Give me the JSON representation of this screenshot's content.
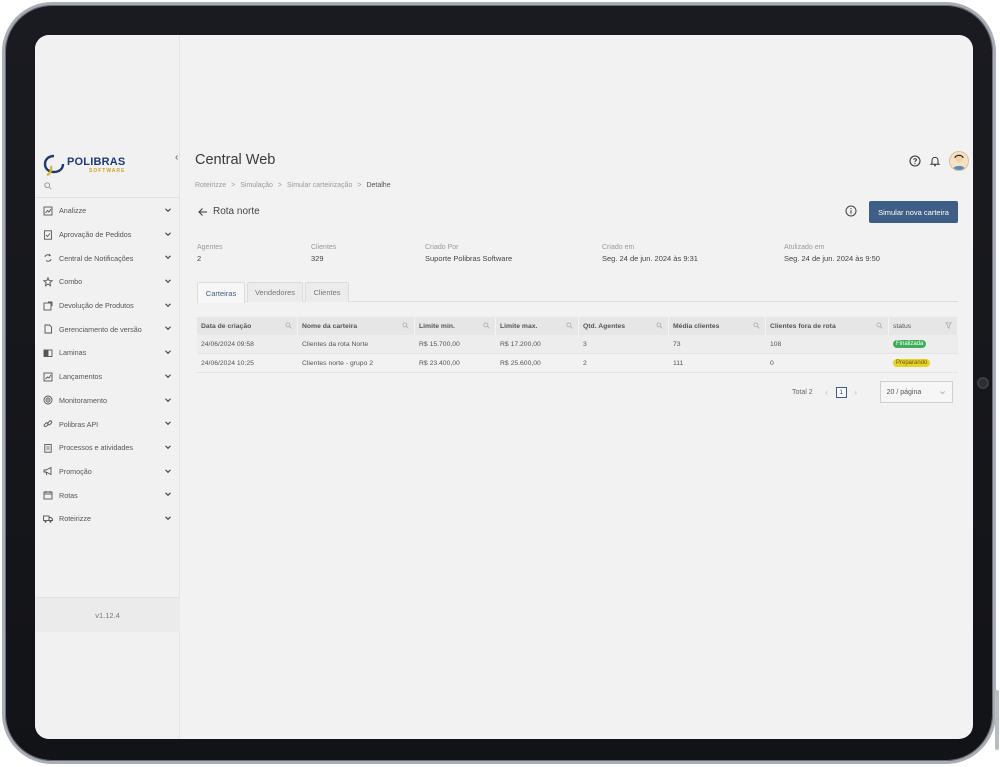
{
  "app": {
    "title": "Central Web",
    "version": "v1.12.4"
  },
  "logo": {
    "name": "POLIBRAS",
    "sub": "SOFTWARE"
  },
  "colors": {
    "primary": "#3e5e86",
    "finalizada": "#3fae5a",
    "preparando": "#e6d32a"
  },
  "sidebar": {
    "items": [
      {
        "label": "Analizze",
        "icon": "chart-icon"
      },
      {
        "label": "Aprovação de Pedidos",
        "icon": "document-check-icon"
      },
      {
        "label": "Central de Notificações",
        "icon": "sync-icon"
      },
      {
        "label": "Combo",
        "icon": "star-icon"
      },
      {
        "label": "Devolução de Produtos",
        "icon": "return-icon"
      },
      {
        "label": "Gerenciamento de versão",
        "icon": "file-icon"
      },
      {
        "label": "Laminas",
        "icon": "book-icon"
      },
      {
        "label": "Lançamentos",
        "icon": "trend-icon"
      },
      {
        "label": "Monitoramento",
        "icon": "target-icon"
      },
      {
        "label": "Polibras API",
        "icon": "link-icon"
      },
      {
        "label": "Processos e atividades",
        "icon": "clipboard-icon"
      },
      {
        "label": "Promoção",
        "icon": "megaphone-icon"
      },
      {
        "label": "Rotas",
        "icon": "calendar-icon"
      },
      {
        "label": "Roteirizze",
        "icon": "truck-icon"
      }
    ]
  },
  "breadcrumb": {
    "items": [
      "Roteirizze",
      "Simulação",
      "Simular carteirização"
    ],
    "current": "Detalhe",
    "separator": ">"
  },
  "page": {
    "title": "Rota norte",
    "primary_button": "Simular nova carteira"
  },
  "summary": [
    {
      "label": "Agentes",
      "value": "2"
    },
    {
      "label": "Clientes",
      "value": "329"
    },
    {
      "label": "Criado Por",
      "value": "Suporte Polibras Software"
    },
    {
      "label": "Criado em",
      "value": "Seg. 24 de jun. 2024 às 9:31"
    },
    {
      "label": "Atulizado em",
      "value": "Seg. 24 de jun. 2024 às 9:50"
    }
  ],
  "tabs": [
    {
      "label": "Carteiras",
      "active": true
    },
    {
      "label": "Vendedores",
      "active": false
    },
    {
      "label": "Clientes",
      "active": false
    }
  ],
  "table": {
    "columns": [
      "Data de criação",
      "Nome da carteira",
      "Limite min.",
      "Limite max.",
      "Qtd. Agentes",
      "Média clientes",
      "Clientes fora de rota",
      "status"
    ],
    "rows": [
      [
        "24/06/2024 09:58",
        "Clientes da rota Norte",
        "R$ 15.700,00",
        "R$ 17.200,00",
        "3",
        "73",
        "108",
        "Finalizada"
      ],
      [
        "24/06/2024 10:25",
        "Clientes norte - grupo 2",
        "R$ 23.400,00",
        "R$ 25.600,00",
        "2",
        "111",
        "0",
        "Preparando"
      ]
    ]
  },
  "pagination": {
    "total": "Total 2",
    "page": "1",
    "page_size": "20 / página"
  }
}
